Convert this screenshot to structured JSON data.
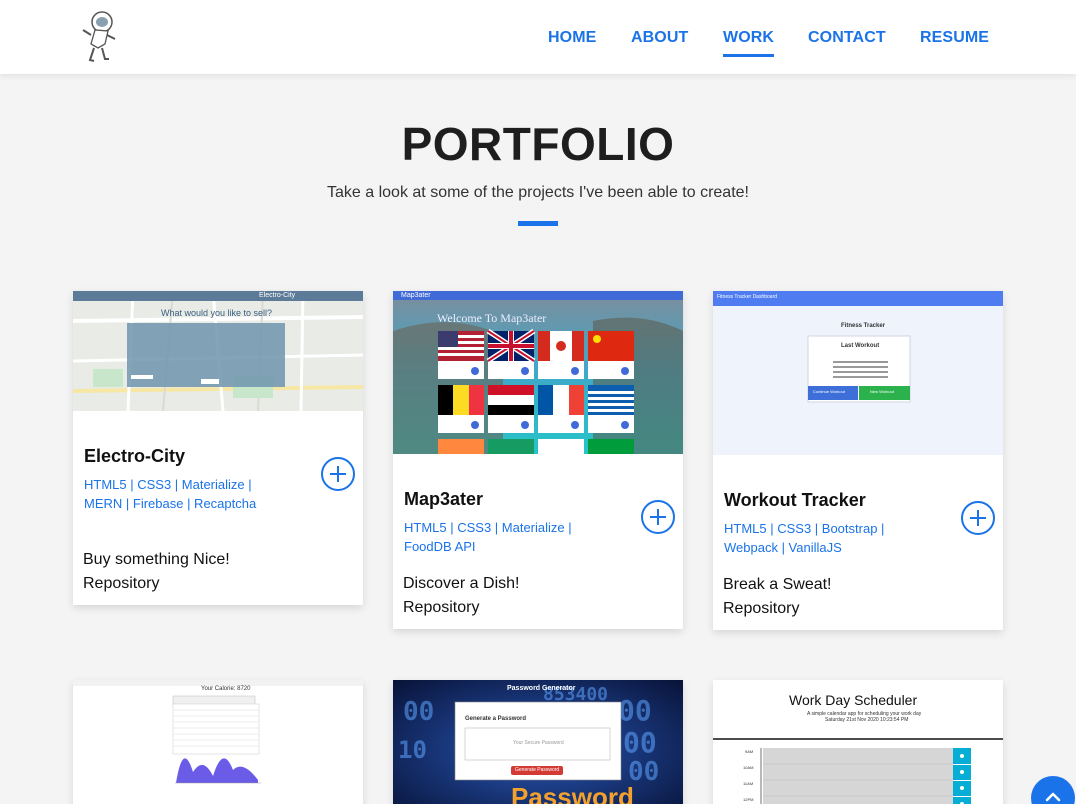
{
  "nav": {
    "logo_icon": "astronaut-logo-icon",
    "links": [
      "HOME",
      "ABOUT",
      "WORK",
      "CONTACT",
      "RESUME"
    ],
    "active": "WORK"
  },
  "portfolio": {
    "title": "PORTFOLIO",
    "subtitle": "Take a look at some of the projects I've been able to create!"
  },
  "projects": [
    {
      "title": "Electro-City",
      "tech": "HTML5 | CSS3 | Materialize | MERN | Firebase | Recaptcha",
      "desc": "Buy something Nice!",
      "repo": "Repository",
      "thumb": {
        "header": "Electro-City",
        "prompt": "What would you like to sell?"
      }
    },
    {
      "title": "Map3ater",
      "tech": "HTML5 | CSS3 | Materialize | FoodDB API",
      "desc": "Discover a Dish!",
      "repo": "Repository",
      "thumb": {
        "header": "Map3ater",
        "banner": "Welcome To Map3ater"
      }
    },
    {
      "title": "Workout Tracker",
      "tech": "HTML5 | CSS3 | Bootstrap | Webpack | VanillaJS",
      "desc": "Break a Sweat!",
      "repo": "Repository",
      "thumb": {
        "header": "Fitness Tracker Dashboard",
        "app_title": "Fitness Tracker",
        "panel_title": "Last Workout",
        "continue": "Continue Workout",
        "new": "New Workout"
      }
    },
    {
      "thumb": {
        "header": "Your Calorie: 8720"
      }
    },
    {
      "thumb": {
        "header": "Password Generator",
        "panel_title": "Generate a Password",
        "placeholder": "Your Secure Password",
        "button": "Generate Password",
        "bg_word": "Password"
      }
    },
    {
      "thumb": {
        "title": "Work Day Scheduler",
        "subtitle": "A simple calendar app for scheduling your work day",
        "date": "Saturday 21st Nov 2020 10:23:54 PM",
        "hours": [
          "9AM",
          "10AM",
          "11AM",
          "12PM"
        ]
      }
    }
  ],
  "colors": {
    "accent": "#1a73e8",
    "background": "#f4f4f4",
    "card": "#ffffff"
  },
  "scroll_top_icon": "chevron-up-icon"
}
